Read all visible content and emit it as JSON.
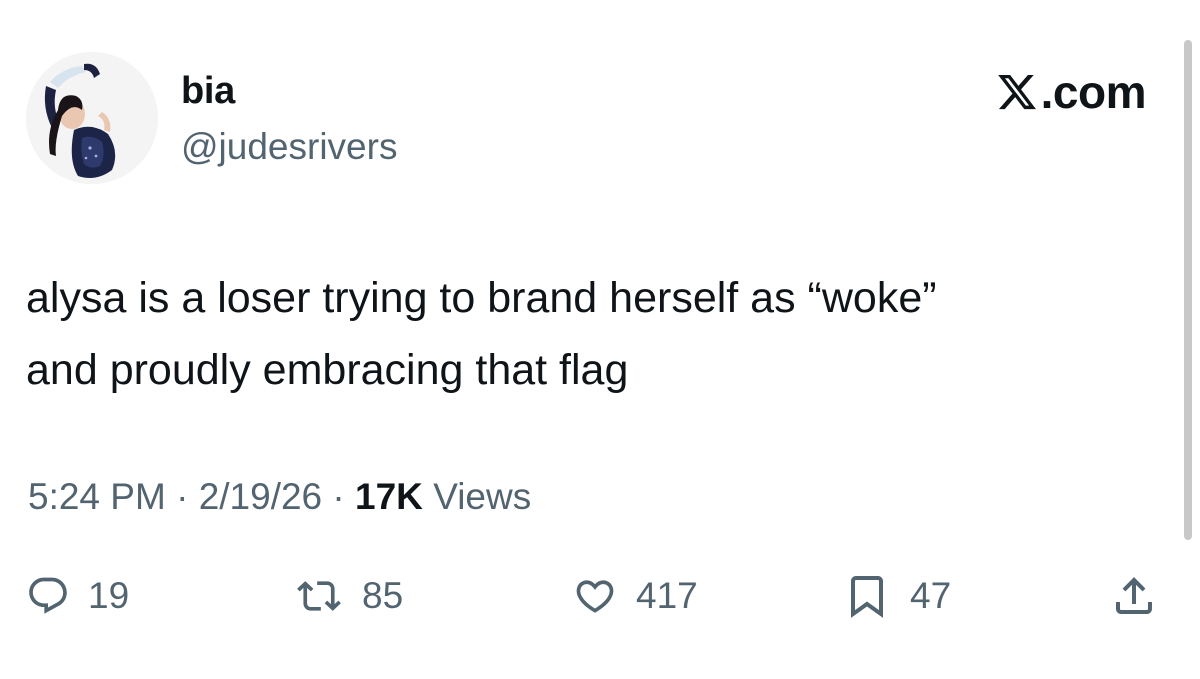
{
  "author": {
    "display_name": "bia",
    "handle": "@judesrivers"
  },
  "brand": {
    "text": ".com"
  },
  "tweet": {
    "lines": [
      "alysa is a loser trying to brand herself as “woke”",
      "and proudly embracing that flag"
    ],
    "time": "5:24 PM",
    "date": "2/19/26",
    "views_count": "17K",
    "views_label": "Views"
  },
  "actions": {
    "replies": "19",
    "reposts": "85",
    "likes": "417",
    "bookmarks": "47"
  },
  "colors": {
    "text": "#0f1419",
    "secondary": "#536471",
    "background": "#ffffff"
  },
  "icons": [
    "avatar",
    "x-logo-icon",
    "reply-icon",
    "repost-icon",
    "like-icon",
    "bookmark-icon",
    "share-icon"
  ]
}
